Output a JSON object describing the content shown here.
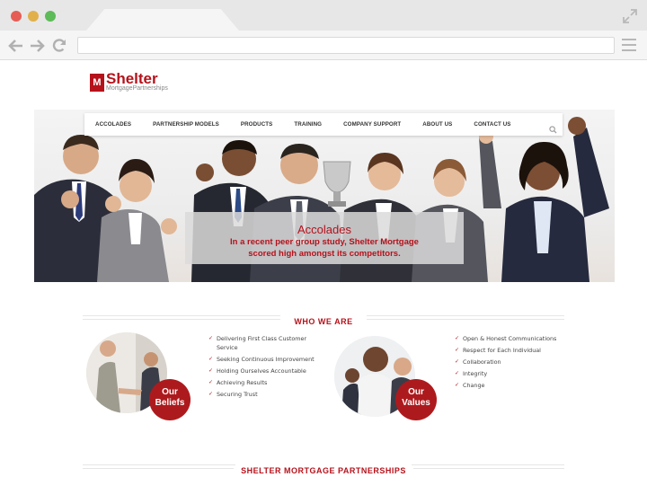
{
  "browser": {
    "icons": [
      "back-arrow-icon",
      "forward-arrow-icon",
      "reload-icon",
      "hamburger-menu-icon",
      "expand-icon"
    ]
  },
  "logo": {
    "mark": "M",
    "name": "Shelter",
    "subtitle": "MortgagePartnerships"
  },
  "nav": {
    "items": [
      "ACCOLADES",
      "PARTNERSHIP MODELS",
      "PRODUCTS",
      "TRAINING",
      "COMPANY SUPPORT",
      "ABOUT US",
      "CONTACT US"
    ],
    "search_icon": "search-icon"
  },
  "hero": {
    "title": "Accolades",
    "text_line1": "In a recent peer group study, Shelter Mortgage",
    "text_line2": "scored high amongst its competitors."
  },
  "who_we_are": {
    "heading": "WHO WE ARE",
    "beliefs": {
      "badge_line1": "Our",
      "badge_line2": "Beliefs",
      "items": [
        "Delivering First Class Customer Service",
        "Seeking Continuous Improvement",
        "Holding Ourselves Accountable",
        "Achieving Results",
        "Securing Trust"
      ]
    },
    "values": {
      "badge_line1": "Our",
      "badge_line2": "Values",
      "items": [
        "Open & Honest Communications",
        "Respect for Each Individual",
        "Collaboration",
        "Integrity",
        "Change"
      ]
    }
  },
  "partnerships": {
    "heading": "SHELTER MORTGAGE PARTNERSHIPS"
  },
  "colors": {
    "brand_red": "#b5121b",
    "badge_red": "#ad1a1d",
    "chrome_gray": "#e7e7e7"
  }
}
